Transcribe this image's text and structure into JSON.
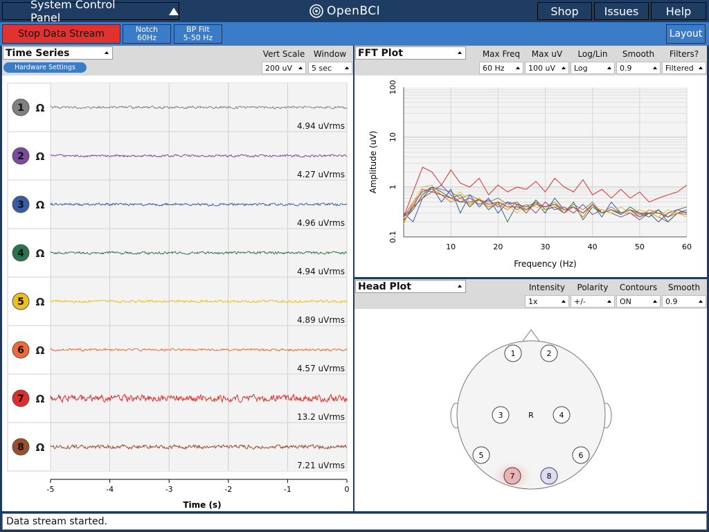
{
  "topbar": {
    "system_control_panel": "System Control Panel",
    "logo_text": "OpenBCI",
    "shop": "Shop",
    "issues": "Issues",
    "help": "Help"
  },
  "toolbar": {
    "stop_stream": "Stop Data Stream",
    "notch_line1": "Notch",
    "notch_line2": "60Hz",
    "bp_line1": "BP Filt",
    "bp_line2": "5-50 Hz",
    "layout": "Layout"
  },
  "time_series": {
    "title": "Time Series",
    "hardware_settings": "Hardware Settings",
    "vert_scale_label": "Vert Scale",
    "vert_scale_value": "200 uV",
    "window_label": "Window",
    "window_value": "5 sec",
    "impedance_glyph": "Ω",
    "channels": [
      {
        "num": "1",
        "color": "#818181",
        "rms": "4.94 uVrms",
        "amp": 1.0
      },
      {
        "num": "2",
        "color": "#7c4b9e",
        "rms": "4.27 uVrms",
        "amp": 0.9
      },
      {
        "num": "3",
        "color": "#3a5aa8",
        "rms": "4.96 uVrms",
        "amp": 1.0
      },
      {
        "num": "4",
        "color": "#2a7350",
        "rms": "4.94 uVrms",
        "amp": 1.0
      },
      {
        "num": "5",
        "color": "#e9c01f",
        "rms": "4.89 uVrms",
        "amp": 1.0
      },
      {
        "num": "6",
        "color": "#f06a33",
        "rms": "4.57 uVrms",
        "amp": 0.9
      },
      {
        "num": "7",
        "color": "#dc2f2c",
        "rms": "13.2 uVrms",
        "amp": 2.7
      },
      {
        "num": "8",
        "color": "#9b4f2b",
        "rms": "7.21 uVrms",
        "amp": 1.5
      }
    ],
    "x_ticks": [
      "-5",
      "-4",
      "-3",
      "-2",
      "-1",
      "0"
    ],
    "xlabel": "Time (s)"
  },
  "fft": {
    "title": "FFT Plot",
    "controls": [
      {
        "label": "Max Freq",
        "value": "60 Hz"
      },
      {
        "label": "Max uV",
        "value": "100 uV"
      },
      {
        "label": "Log/Lin",
        "value": "Log"
      },
      {
        "label": "Smooth",
        "value": "0.9"
      },
      {
        "label": "Filters?",
        "value": "Filtered"
      }
    ]
  },
  "chart_data": {
    "type": "line",
    "xlabel": "Frequency (Hz)",
    "ylabel": "Amplitude (uV)",
    "xlim": [
      0,
      60
    ],
    "ylim": [
      0.1,
      100
    ],
    "yscale": "log",
    "x_ticks": [
      "10",
      "20",
      "30",
      "40",
      "50",
      "60"
    ],
    "y_ticks": [
      "0.1",
      "1",
      "10",
      "100"
    ],
    "grid": true,
    "x": [
      0,
      2,
      4,
      6,
      8,
      10,
      12,
      14,
      16,
      18,
      20,
      22,
      24,
      26,
      28,
      30,
      32,
      34,
      36,
      38,
      40,
      42,
      44,
      46,
      48,
      50,
      52,
      54,
      56,
      58,
      60
    ],
    "series": [
      {
        "color": "#818181",
        "values": [
          0.25,
          0.5,
          0.8,
          1.0,
          0.9,
          0.8,
          0.6,
          0.7,
          0.55,
          0.5,
          0.6,
          0.45,
          0.5,
          0.35,
          0.5,
          0.4,
          0.5,
          0.3,
          0.45,
          0.35,
          0.5,
          0.3,
          0.4,
          0.3,
          0.35,
          0.28,
          0.3,
          0.35,
          0.25,
          0.3,
          0.32
        ]
      },
      {
        "color": "#7c4b9e",
        "values": [
          0.2,
          0.4,
          0.9,
          0.8,
          1.1,
          0.7,
          0.5,
          0.6,
          0.45,
          0.55,
          0.4,
          0.5,
          0.35,
          0.45,
          0.3,
          0.5,
          0.35,
          0.4,
          0.3,
          0.45,
          0.28,
          0.35,
          0.3,
          0.25,
          0.3,
          0.22,
          0.3,
          0.25,
          0.2,
          0.3,
          0.35
        ]
      },
      {
        "color": "#3a5aa8",
        "values": [
          0.3,
          0.2,
          0.6,
          1.0,
          0.5,
          0.9,
          0.3,
          0.7,
          0.4,
          0.6,
          0.3,
          0.5,
          0.45,
          0.4,
          0.5,
          0.3,
          0.6,
          0.35,
          0.4,
          0.3,
          0.45,
          0.25,
          0.5,
          0.3,
          0.35,
          0.25,
          0.3,
          0.2,
          0.3,
          0.35,
          0.3
        ]
      },
      {
        "color": "#2a7350",
        "values": [
          0.22,
          0.35,
          0.7,
          1.0,
          0.8,
          0.6,
          0.7,
          0.4,
          0.6,
          0.35,
          0.5,
          0.2,
          0.45,
          0.3,
          0.55,
          0.35,
          0.4,
          0.3,
          0.5,
          0.22,
          0.4,
          0.3,
          0.35,
          0.28,
          0.4,
          0.3,
          0.25,
          0.35,
          0.2,
          0.3,
          0.28
        ]
      },
      {
        "color": "#e9c01f",
        "values": [
          0.18,
          0.5,
          1.0,
          1.1,
          0.7,
          0.6,
          0.8,
          0.5,
          0.6,
          0.4,
          0.5,
          0.45,
          0.3,
          0.45,
          0.4,
          0.35,
          0.5,
          0.35,
          0.4,
          0.3,
          0.4,
          0.35,
          0.3,
          0.4,
          0.3,
          0.35,
          0.3,
          0.25,
          0.35,
          0.3,
          0.25
        ]
      },
      {
        "color": "#f06a33",
        "values": [
          0.2,
          0.45,
          0.8,
          0.9,
          0.7,
          0.5,
          0.6,
          0.45,
          0.55,
          0.4,
          0.45,
          0.35,
          0.5,
          0.3,
          0.5,
          0.4,
          0.45,
          0.3,
          0.4,
          0.25,
          0.45,
          0.3,
          0.35,
          0.3,
          0.3,
          0.25,
          0.35,
          0.3,
          0.25,
          0.3,
          0.28
        ]
      },
      {
        "color": "#dc2f2c",
        "values": [
          0.25,
          0.8,
          2.5,
          2.0,
          1.1,
          2.2,
          1.2,
          1.0,
          1.5,
          0.7,
          1.1,
          0.8,
          1.0,
          0.9,
          1.3,
          0.8,
          1.5,
          1.0,
          0.8,
          1.4,
          0.7,
          0.9,
          0.6,
          0.9,
          0.6,
          0.8,
          0.5,
          0.6,
          0.7,
          0.8,
          1.1
        ]
      },
      {
        "color": "#9b4f2b",
        "values": [
          0.25,
          0.4,
          0.6,
          0.8,
          0.7,
          0.6,
          0.5,
          0.5,
          0.55,
          0.45,
          0.5,
          0.4,
          0.4,
          0.35,
          0.45,
          0.4,
          0.45,
          0.35,
          0.4,
          0.3,
          0.45,
          0.3,
          0.35,
          0.3,
          0.35,
          0.3,
          0.3,
          0.3,
          0.25,
          0.35,
          0.4
        ]
      }
    ]
  },
  "head_plot": {
    "title": "Head Plot",
    "controls": [
      {
        "label": "Intensity",
        "value": "1x"
      },
      {
        "label": "Polarity",
        "value": "+/-"
      },
      {
        "label": "Contours",
        "value": "ON"
      },
      {
        "label": "Smooth",
        "value": "0.9"
      }
    ],
    "electrodes": [
      "1",
      "2",
      "3",
      "4",
      "5",
      "6",
      "7",
      "8"
    ],
    "reference": "R"
  },
  "status": "Data stream started."
}
